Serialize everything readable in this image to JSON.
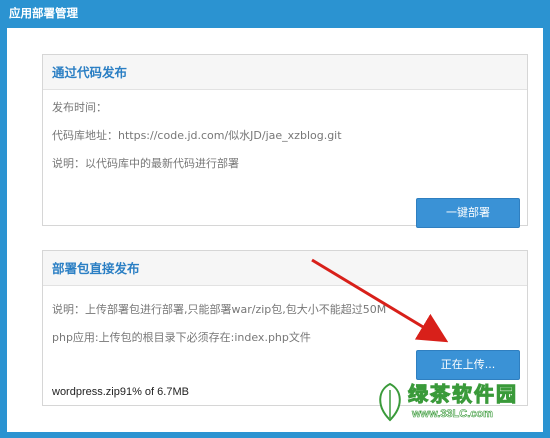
{
  "window": {
    "title": "应用部署管理"
  },
  "code_publish": {
    "title": "通过代码发布",
    "publish_time_label": "发布时间：",
    "repo_label": "代码库地址：https://code.jd.com/似水JD/jae_xzblog.git",
    "description": "说明：以代码库中的最新代码进行部署",
    "deploy_button": "一键部署"
  },
  "package_publish": {
    "title": "部署包直接发布",
    "description": "说明：上传部署包进行部署,只能部署war/zip包,包大小不能超过50M",
    "php_note": "php应用:上传包的根目录下必须存在:index.php文件",
    "upload_button": "正在上传...",
    "upload_progress": "wordpress.zip91% of 6.7MB"
  },
  "annotation": {
    "arrow_color": "#d8201a"
  },
  "watermark": {
    "title": "绿茶软件园",
    "url": "www.33LC.com"
  },
  "colors": {
    "accent": "#2b93d1",
    "button": "#3a92d6",
    "heading": "#2b7fc4"
  }
}
